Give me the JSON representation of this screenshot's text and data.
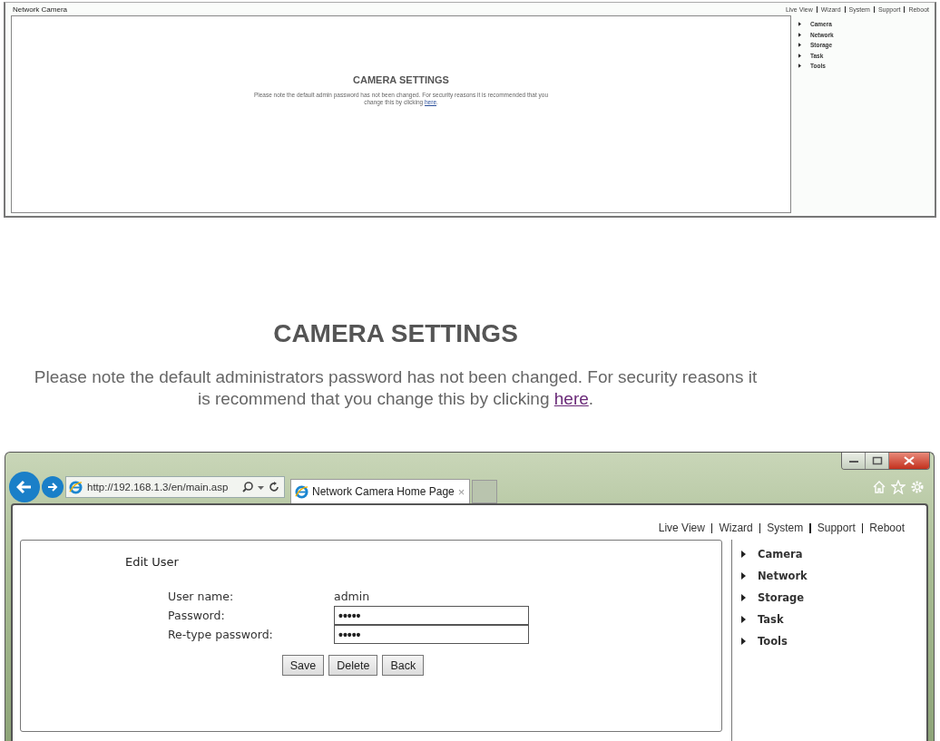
{
  "overview_screen": {
    "title": "Network Camera",
    "top_links": [
      "Live View",
      "Wizard",
      "System",
      "Support",
      "Reboot"
    ],
    "menu": [
      "Camera",
      "Network",
      "Storage",
      "Task",
      "Tools"
    ],
    "heading": "CAMERA SETTINGS",
    "notice": {
      "before": "Please note the default admin password has not been changed. For security reasons it is recommended that you change this by clicking ",
      "link": "here",
      "after": "."
    }
  },
  "closeup": {
    "heading": "CAMERA SETTINGS",
    "notice": {
      "before": "Please note the default administrators password has not been changed. For security reasons it is recommend that you change this by clicking ",
      "link": "here",
      "after": "."
    }
  },
  "browser": {
    "address": "http://192.168.1.3/en/main.asp",
    "tab": {
      "title": "Network Camera Home Page",
      "close": "×"
    },
    "top_links": [
      "Live View",
      "Wizard",
      "System",
      "Support",
      "Reboot"
    ],
    "menu": [
      "Camera",
      "Network",
      "Storage",
      "Task",
      "Tools"
    ],
    "form": {
      "title": "Edit User",
      "fields": [
        {
          "kind": "text",
          "label": "User name:",
          "value": "admin"
        },
        {
          "kind": "password",
          "label": "Password:",
          "value": "•••••"
        },
        {
          "kind": "password",
          "label": "Re-type password:",
          "value": "•••••"
        }
      ],
      "buttons": [
        "Save",
        "Delete",
        "Back"
      ]
    }
  }
}
